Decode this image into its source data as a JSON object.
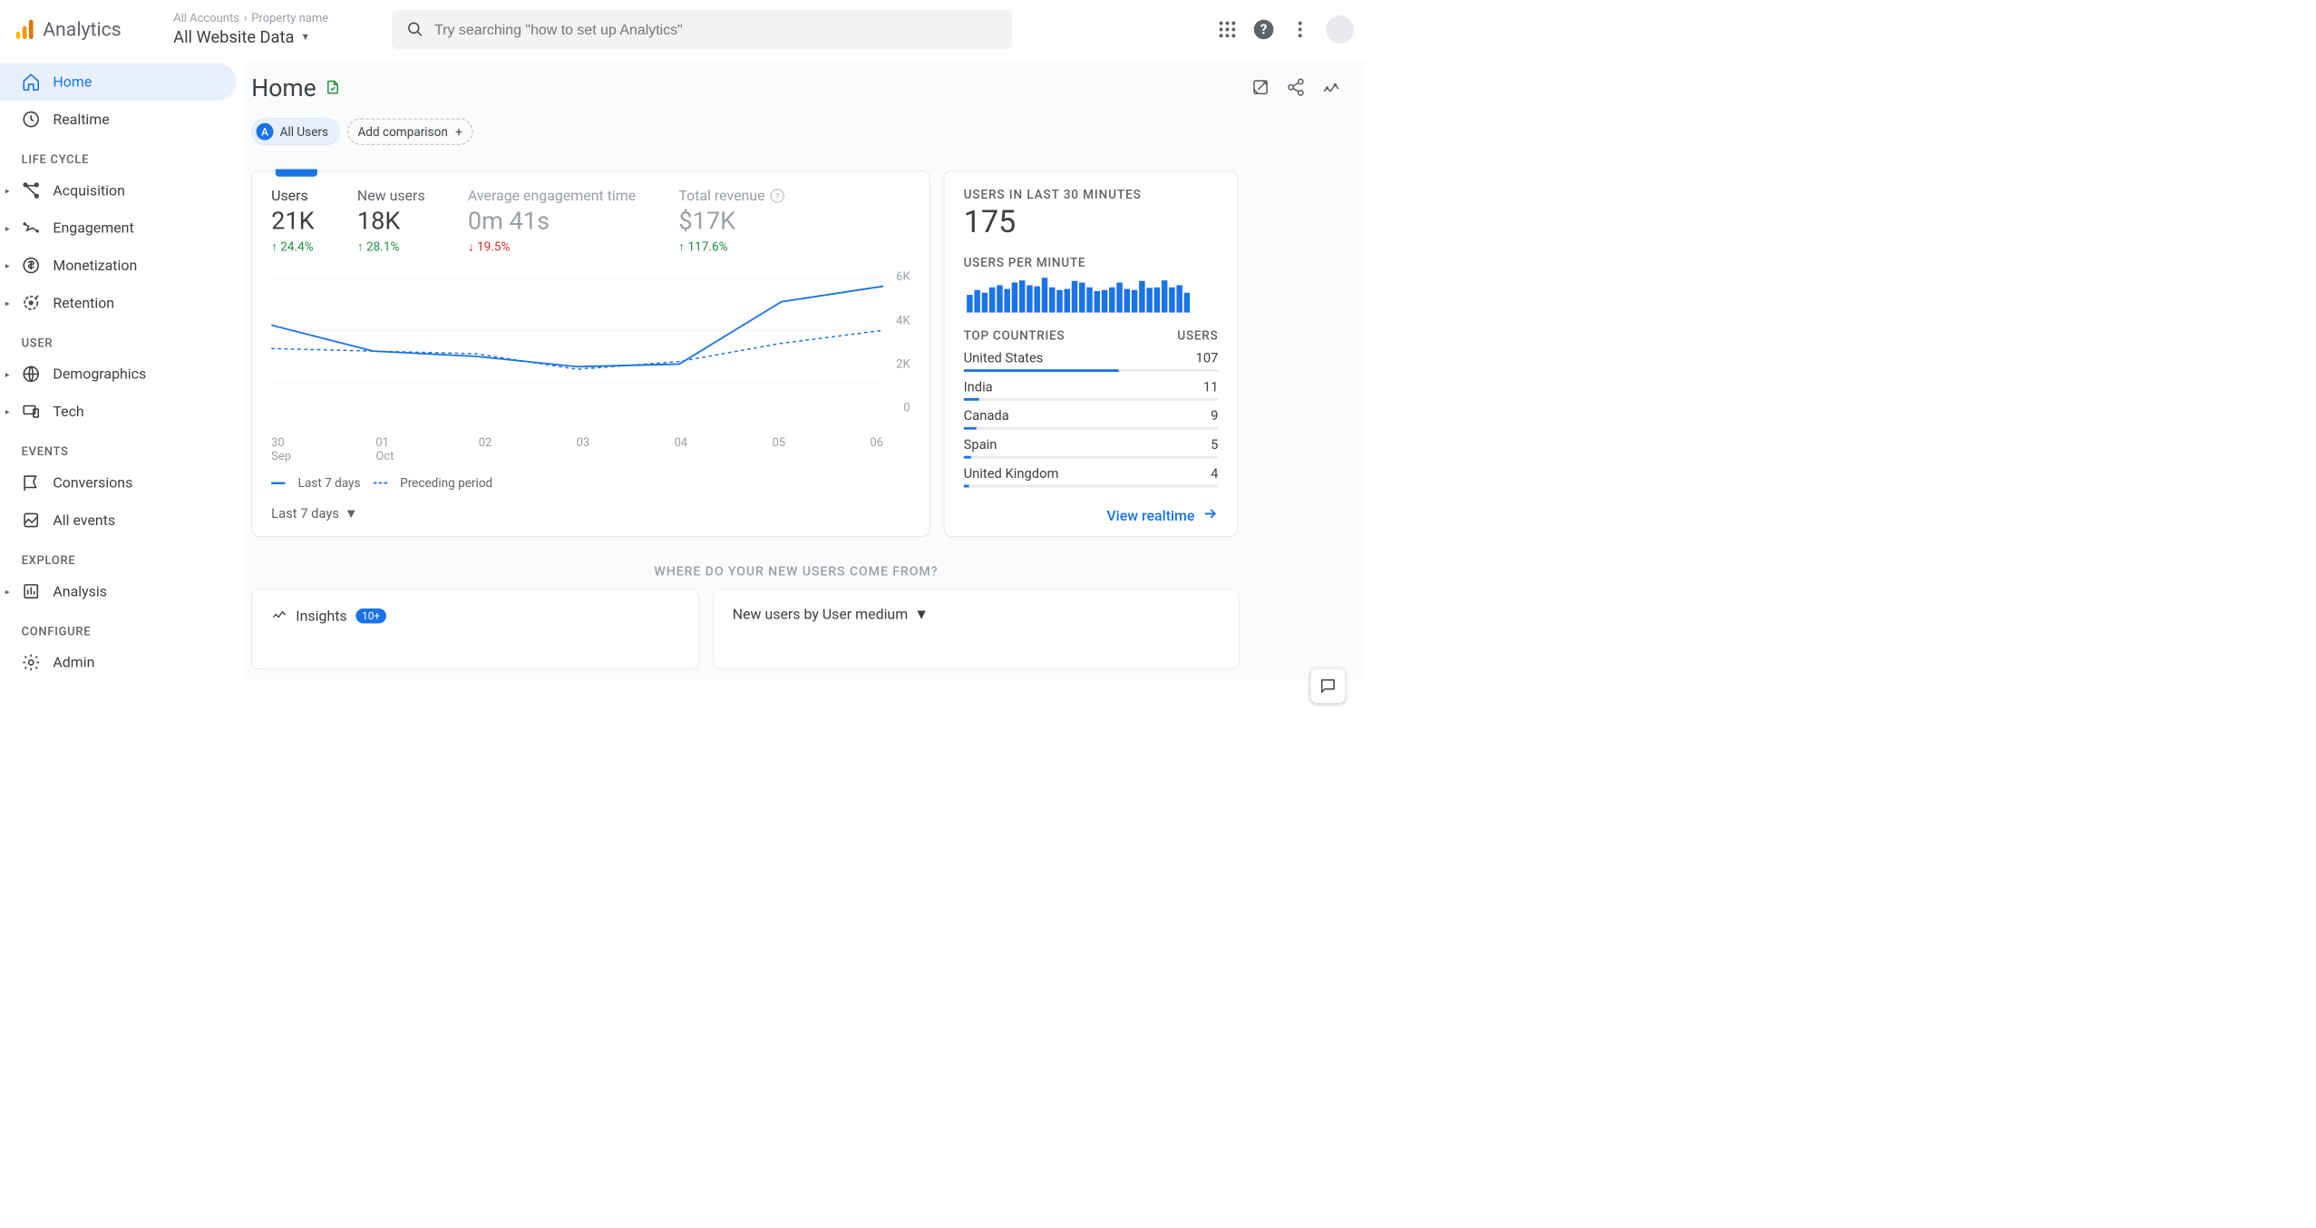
{
  "header": {
    "product_name": "Analytics",
    "breadcrumb_root": "All Accounts",
    "breadcrumb_property": "Property name",
    "view_selector": "All Website Data",
    "search_placeholder": "Try searching \"how to set up Analytics\""
  },
  "sidebar": {
    "items_top": [
      {
        "label": "Home",
        "active": true
      },
      {
        "label": "Realtime",
        "active": false
      }
    ],
    "sections": [
      {
        "title": "LIFE CYCLE",
        "items": [
          "Acquisition",
          "Engagement",
          "Monetization",
          "Retention"
        ]
      },
      {
        "title": "USER",
        "items": [
          "Demographics",
          "Tech"
        ]
      },
      {
        "title": "EVENTS",
        "items": [
          "Conversions",
          "All events"
        ]
      },
      {
        "title": "EXPLORE",
        "items": [
          "Analysis"
        ]
      },
      {
        "title": "CONFIGURE",
        "items": [
          "Admin"
        ]
      }
    ]
  },
  "page": {
    "title": "Home",
    "filter_segment_letter": "A",
    "filter_segment_label": "All Users",
    "add_comparison_label": "Add comparison"
  },
  "metrics": [
    {
      "label": "Users",
      "value": "21K",
      "change": "24.4%",
      "dir": "up",
      "selected": true
    },
    {
      "label": "New users",
      "value": "18K",
      "change": "28.1%",
      "dir": "up"
    },
    {
      "label": "Average engagement time",
      "value": "0m 41s",
      "change": "19.5%",
      "dir": "down",
      "dim": true
    },
    {
      "label": "Total revenue",
      "value": "$17K",
      "change": "117.6%",
      "dir": "up",
      "help": true,
      "dim": true
    }
  ],
  "chart_data": {
    "type": "line",
    "x": [
      "30 Sep",
      "01 Oct",
      "02",
      "03",
      "04",
      "05",
      "06"
    ],
    "y_ticks": [
      "6K",
      "4K",
      "2K",
      "0"
    ],
    "ylim": [
      0,
      6000
    ],
    "series": [
      {
        "name": "Last 7 days",
        "values": [
          4200,
          3200,
          3000,
          2600,
          2700,
          5100,
          5700
        ]
      },
      {
        "name": "Preceding period",
        "values": [
          3300,
          3200,
          3100,
          2500,
          2800,
          3500,
          4000
        ]
      }
    ],
    "legend": [
      "Last 7 days",
      "Preceding period"
    ],
    "period_selector": "Last 7 days"
  },
  "realtime": {
    "title": "USERS IN LAST 30 MINUTES",
    "value": "175",
    "subtitle": "USERS PER MINUTE",
    "bars": [
      30,
      40,
      35,
      45,
      50,
      42,
      55,
      60,
      50,
      48,
      65,
      45,
      40,
      42,
      58,
      55,
      45,
      38,
      40,
      45,
      55,
      42,
      40,
      58,
      44,
      46,
      60,
      45,
      50,
      35
    ],
    "countries_header": {
      "left": "TOP COUNTRIES",
      "right": "USERS"
    },
    "countries": [
      {
        "name": "United States",
        "users": 107,
        "pct": 61
      },
      {
        "name": "India",
        "users": 11,
        "pct": 6
      },
      {
        "name": "Canada",
        "users": 9,
        "pct": 5
      },
      {
        "name": "Spain",
        "users": 5,
        "pct": 3
      },
      {
        "name": "United Kingdom",
        "users": 4,
        "pct": 2
      }
    ],
    "view_link": "View realtime"
  },
  "second_row": {
    "where_title": "WHERE DO YOUR NEW USERS COME FROM?",
    "insights_label": "Insights",
    "insights_badge": "10+",
    "origin_dropdown": "New users by User medium"
  }
}
